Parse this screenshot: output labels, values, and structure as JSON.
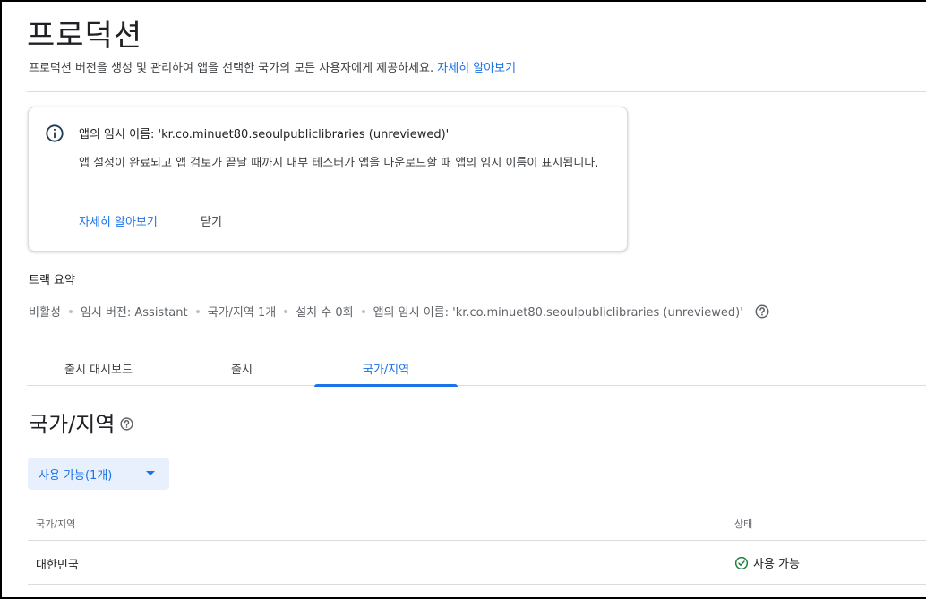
{
  "header": {
    "title": "프로덕션",
    "subtitle": "프로덕션 버전을 생성 및 관리하여 앱을 선택한 국가의 모든 사용자에게 제공하세요.",
    "subtitle_link": "자세히 알아보기"
  },
  "notice": {
    "icon": "info-icon",
    "title": "앱의 임시 이름: 'kr.co.minuet80.seoulpubliclibraries (unreviewed)'",
    "body": "앱 설정이 완료되고 앱 검토가 끝날 때까지 내부 테스터가 앱을 다운로드할 때 앱의 임시 이름이 표시됩니다.",
    "learn_more": "자세히 알아보기",
    "dismiss": "닫기"
  },
  "track_summary": {
    "label": "트랙 요약",
    "items": [
      "비활성",
      "임시 버전: Assistant",
      "국가/지역 1개",
      "설치 수 0회",
      "앱의 임시 이름: 'kr.co.minuet80.seoulpubliclibraries (unreviewed)'"
    ],
    "help_icon": "help-icon"
  },
  "tabs": [
    {
      "label": "출시 대시보드",
      "active": false
    },
    {
      "label": "출시",
      "active": false
    },
    {
      "label": "국가/지역",
      "active": true
    }
  ],
  "countries": {
    "heading": "국가/지역",
    "filter_label": "사용 가능(1개)",
    "columns": [
      "국가/지역",
      "상태"
    ],
    "rows": [
      {
        "country": "대한민국",
        "status": "사용 가능"
      }
    ]
  },
  "colors": {
    "accent": "#1a73e8",
    "success": "#188038",
    "divider": "#dadce0"
  }
}
